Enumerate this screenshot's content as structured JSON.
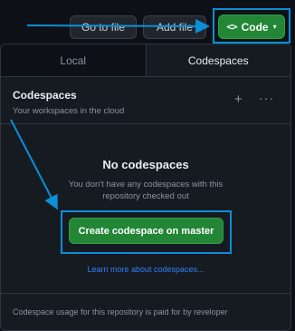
{
  "toolbar": {
    "go_to_file": "Go to file",
    "add_file": "Add file",
    "add_file_caret": "▾",
    "code": "Code",
    "code_icon_glyph": "<>",
    "code_caret": "▾"
  },
  "tabs": [
    {
      "label": "Local",
      "selected": false
    },
    {
      "label": "Codespaces",
      "selected": true
    }
  ],
  "codespaces": {
    "title": "Codespaces",
    "subtitle": "Your workspaces in the cloud",
    "plus_glyph": "+",
    "more_glyph": "···"
  },
  "empty_state": {
    "title": "No codespaces",
    "description": "You don't have any codespaces with this repository checked out",
    "create_button": "Create codespace on master",
    "learn_more": "Learn more about codespaces..."
  },
  "footer": {
    "text": "Codespace usage for this repository is paid for by reveloper"
  },
  "colors": {
    "background": "#0d1117",
    "panel": "#161b22",
    "border": "#30363d",
    "primary_button": "#238636",
    "link": "#2f81f7",
    "annotation": "#0b8fd6"
  },
  "icons": [
    "code-icon",
    "caret-down-icon",
    "plus-icon",
    "kebab-menu-icon"
  ]
}
